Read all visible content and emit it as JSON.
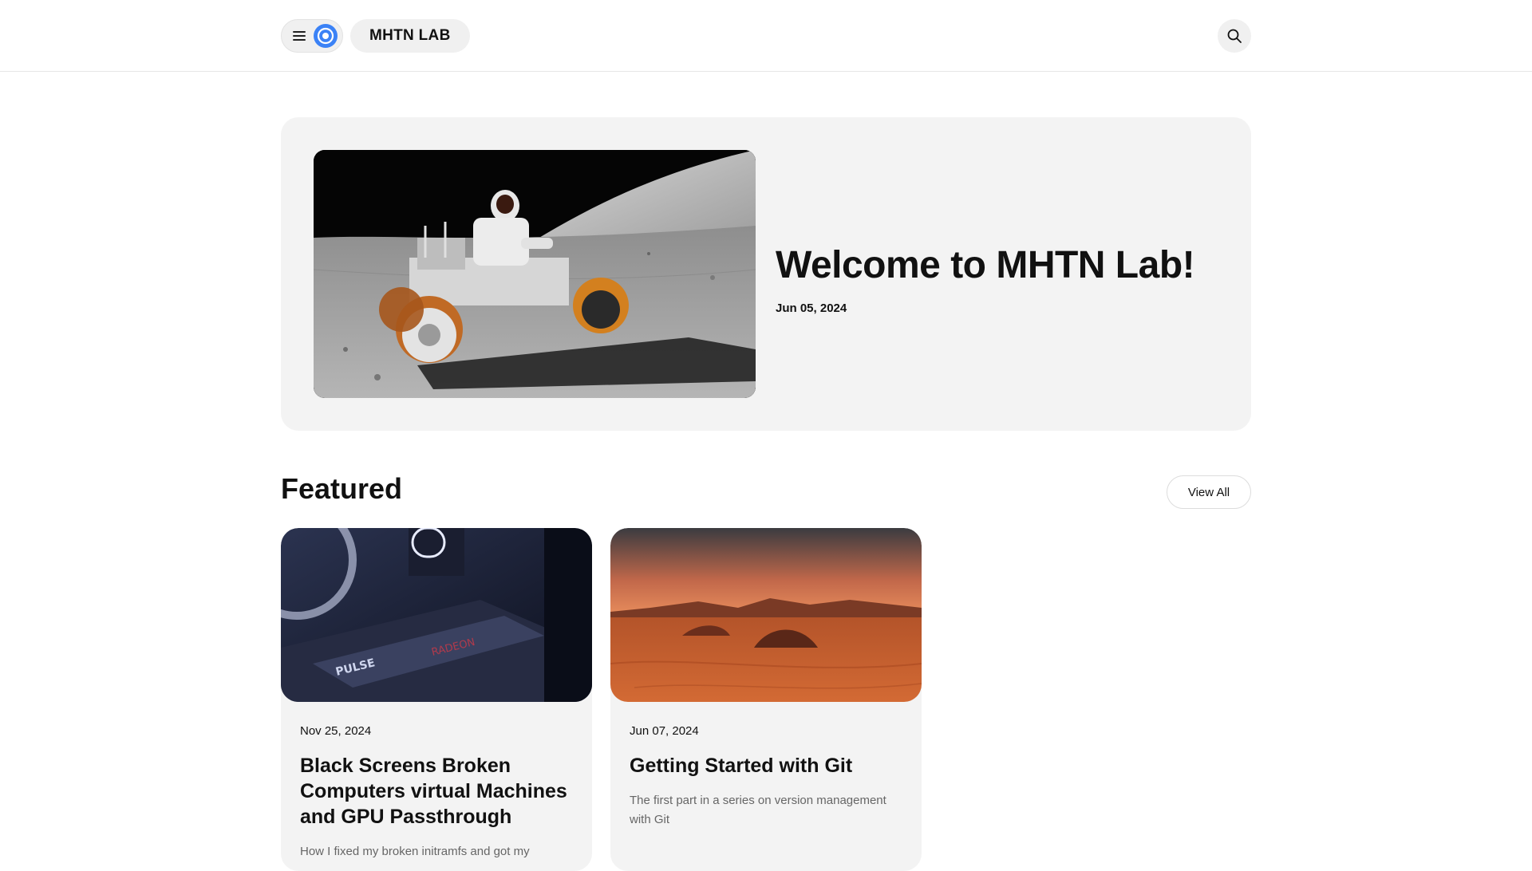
{
  "header": {
    "brand": "MHTN LAB",
    "accent_color": "#3b82f6",
    "menu_icon": "hamburger-icon",
    "logo_icon": "ring-logo-icon",
    "search_icon": "search-icon"
  },
  "hero": {
    "title": "Welcome to MHTN Lab!",
    "date": "Jun 05, 2024",
    "image": "astronaut-lunar-rover-photo"
  },
  "featured": {
    "heading": "Featured",
    "view_all_label": "View All",
    "cards": [
      {
        "date": "Nov 25, 2024",
        "title": "Black Screens Broken Computers virtual Machines and GPU Passthrough",
        "description": "How I fixed my broken initramfs and got my",
        "image": "pc-graphics-card-photo"
      },
      {
        "date": "Jun 07, 2024",
        "title": "Getting Started with Git",
        "description": "The first part in a series on version management with Git",
        "image": "martian-desert-photo"
      }
    ]
  }
}
